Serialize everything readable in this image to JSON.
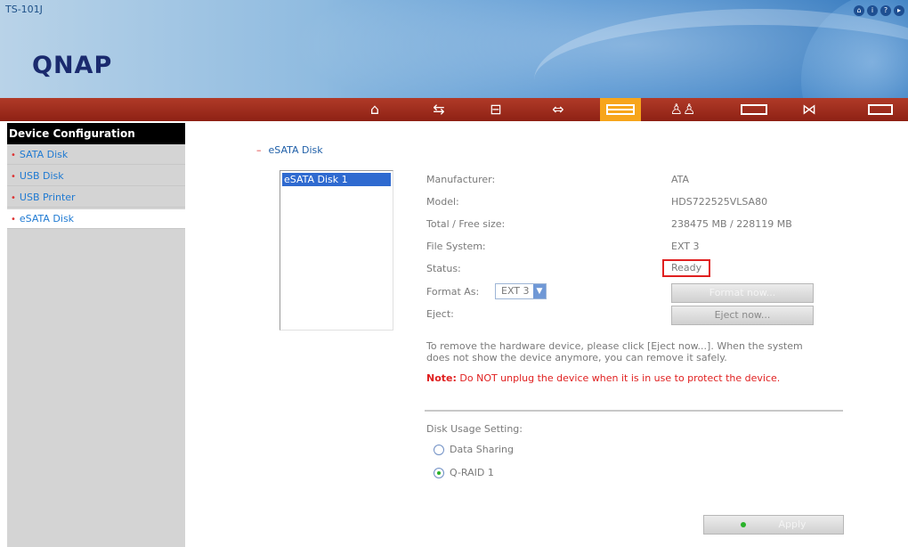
{
  "header": {
    "model": "TS-101J",
    "logo": "QNAP",
    "top_icons": [
      "home-icon",
      "info-icon",
      "help-icon",
      "logout-icon"
    ]
  },
  "nav": {
    "icons": [
      "home-icon",
      "network-icon",
      "system-icon",
      "services-icon",
      "device-icon",
      "users-icon",
      "share-icon",
      "statistics-icon",
      "logs-icon"
    ],
    "active": "device-icon",
    "colors": {
      "bar": "#9a2a18",
      "active": "#f7a51b"
    }
  },
  "sidebar": {
    "title": "Device Configuration",
    "items": [
      {
        "label": "SATA Disk"
      },
      {
        "label": "USB Disk"
      },
      {
        "label": "USB Printer"
      },
      {
        "label": "eSATA Disk",
        "active": true
      }
    ]
  },
  "main": {
    "section_title": "eSATA Disk",
    "disk_list": [
      "eSATA Disk 1"
    ],
    "fields": {
      "manufacturer_label": "Manufacturer:",
      "manufacturer_value": "ATA",
      "model_label": "Model:",
      "model_value": "HDS722525VLSA80",
      "size_label": "Total / Free size:",
      "size_value": "238475 MB / 228119 MB",
      "fs_label": "File System:",
      "fs_value": "EXT 3",
      "status_label": "Status:",
      "status_value": "Ready",
      "format_label": "Format As:",
      "format_value": "EXT 3",
      "eject_label": "Eject:"
    },
    "buttons": {
      "format": "Format now...",
      "eject": "Eject now...",
      "apply": "Apply"
    },
    "info_text": "To remove the hardware device, please click [Eject now...]. When the system does not show the device anymore, you can remove it safely.",
    "note_label": "Note:",
    "note_text": " Do NOT unplug the device when it is in use to protect the device.",
    "usage": {
      "title": "Disk Usage Setting:",
      "options": [
        {
          "label": "Data Sharing",
          "checked": false
        },
        {
          "label": "Q-RAID 1",
          "checked": true
        }
      ]
    }
  }
}
